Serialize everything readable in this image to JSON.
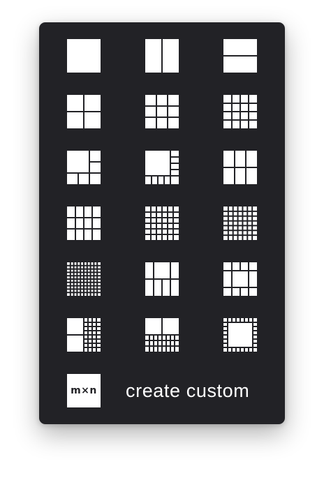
{
  "colors": {
    "panel": "#222226",
    "tile": "#ffffff",
    "gap": "#222226"
  },
  "layouts": [
    {
      "id": "layout-1x1-icon"
    },
    {
      "id": "layout-2-columns-icon"
    },
    {
      "id": "layout-2-rows-icon"
    },
    {
      "id": "layout-2x2-icon"
    },
    {
      "id": "layout-3x3-icon"
    },
    {
      "id": "layout-4x4-icon"
    },
    {
      "id": "layout-1-large-plus-5-icon"
    },
    {
      "id": "layout-1-large-plus-7-icon"
    },
    {
      "id": "layout-2-tall-plus-4-icon"
    },
    {
      "id": "layout-4x3-icon"
    },
    {
      "id": "layout-5x5-icon"
    },
    {
      "id": "layout-6x6-icon"
    },
    {
      "id": "layout-8x8-icon"
    },
    {
      "id": "layout-center-2x2-with-sides-icon"
    },
    {
      "id": "layout-center-large-with-border-icon"
    },
    {
      "id": "layout-large-left-plus-grid-icon"
    },
    {
      "id": "layout-2-top-plus-small-grid-icon"
    },
    {
      "id": "layout-large-center-ring-icon"
    }
  ],
  "custom": {
    "badge_label": "m×n",
    "label": "create custom"
  }
}
